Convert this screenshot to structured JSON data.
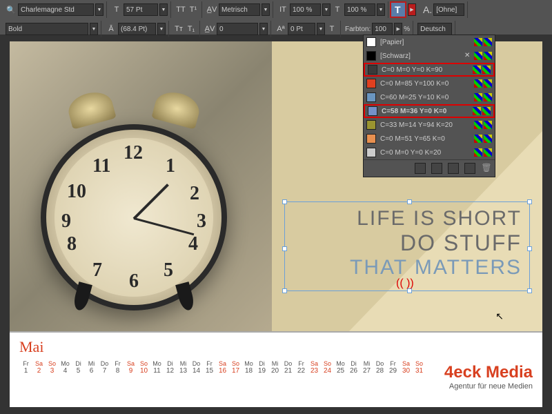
{
  "toolbar": {
    "font_search_icon": "🔍",
    "font_family": "Charlemagne Std",
    "font_style": "Bold",
    "font_size": "57 Pt",
    "leading": "(68.4 Pt)",
    "kerning_mode": "Metrisch",
    "tracking": "0",
    "vert_scale": "100 %",
    "horz_scale": "100 %",
    "baseline_shift": "0 Pt",
    "char_style": "[Ohne]",
    "language": "Deutsch",
    "tint_label": "Farbton:",
    "tint_value": "100",
    "tint_unit": "%"
  },
  "swatches": [
    {
      "name": "[Papier]",
      "color": "#ffffff",
      "none": false,
      "reg": false
    },
    {
      "name": "[Schwarz]",
      "color": "#000000",
      "none": false,
      "reg": true
    },
    {
      "name": "C=0 M=0 Y=0 K=90",
      "color": "#3a3a3a",
      "hl": true
    },
    {
      "name": "C=0 M=85 Y=100 K=0",
      "color": "#e04020"
    },
    {
      "name": "C=60 M=25 Y=10 K=0",
      "color": "#6a95c0"
    },
    {
      "name": "C=58 M=36 Y=0 K=0",
      "color": "#7590c8",
      "hl": true,
      "bold": true
    },
    {
      "name": "C=33 M=14 Y=94 K=20",
      "color": "#9a9430"
    },
    {
      "name": "C=0 M=51 Y=65 K=0",
      "color": "#e89050"
    },
    {
      "name": "C=0 M=0 Y=0 K=20",
      "color": "#cccccc"
    }
  ],
  "quote": {
    "line1": "LIFE IS SHORT",
    "line2": "DO STUFF",
    "line3": "THAT MATTERS",
    "overset": "((  ))"
  },
  "calendar": {
    "month": "Mai",
    "day_names": [
      "Fr",
      "Sa",
      "So",
      "Mo",
      "Di",
      "Mi",
      "Do",
      "Fr",
      "Sa",
      "So",
      "Mo",
      "Di",
      "Mi",
      "Do",
      "Fr",
      "Sa",
      "So",
      "Mo",
      "Di",
      "Mi",
      "Do",
      "Fr",
      "Sa",
      "So",
      "Mo",
      "Di",
      "Mi",
      "Do",
      "Fr",
      "Sa",
      "So"
    ],
    "day_nums": [
      1,
      2,
      3,
      4,
      5,
      6,
      7,
      8,
      9,
      10,
      11,
      12,
      13,
      14,
      15,
      16,
      17,
      18,
      19,
      20,
      21,
      22,
      23,
      24,
      25,
      26,
      27,
      28,
      29,
      30,
      31
    ],
    "weekend_idx": [
      1,
      2,
      8,
      9,
      15,
      16,
      22,
      23,
      29,
      30
    ]
  },
  "brand": {
    "name": "4eck Media",
    "sub": "Agentur für neue Medien"
  },
  "clock_numbers": {
    "n12": "12",
    "n1": "1",
    "n2": "2",
    "n3": "3",
    "n4": "4",
    "n5": "5",
    "n6": "6",
    "n7": "7",
    "n8": "8",
    "n9": "9",
    "n10": "10",
    "n11": "11"
  }
}
